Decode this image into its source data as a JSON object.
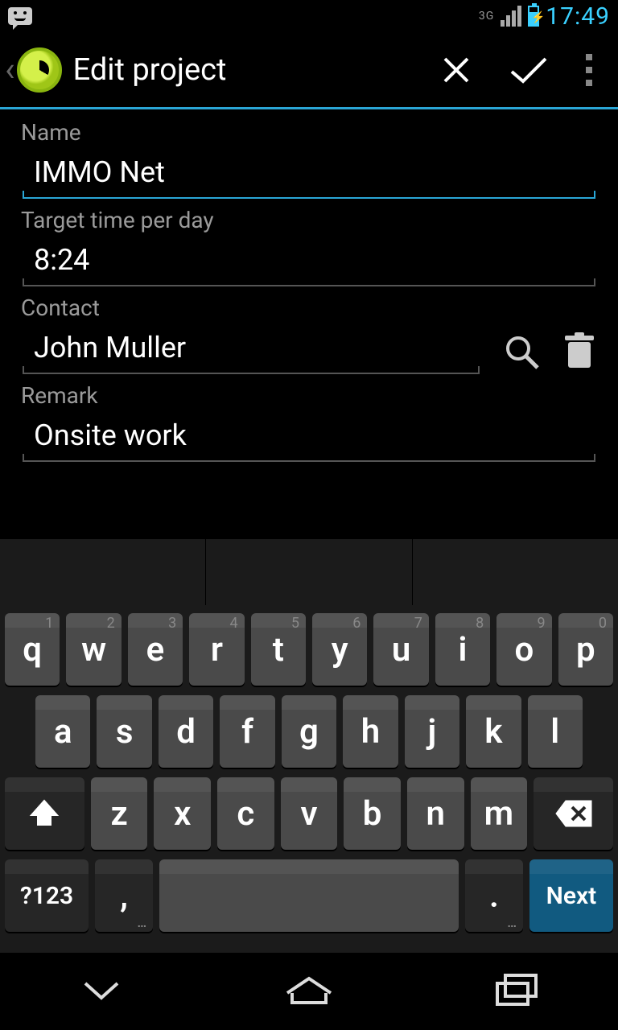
{
  "statusbar": {
    "network": "3G",
    "time": "17:49"
  },
  "actionbar": {
    "title": "Edit project"
  },
  "form": {
    "name_label": "Name",
    "name_value": "IMMO Net",
    "target_label": "Target time per day",
    "target_value": "8:24",
    "contact_label": "Contact",
    "contact_value": "John Muller",
    "remark_label": "Remark",
    "remark_value": "Onsite work"
  },
  "keyboard": {
    "row1": [
      {
        "k": "q",
        "h": "1"
      },
      {
        "k": "w",
        "h": "2"
      },
      {
        "k": "e",
        "h": "3"
      },
      {
        "k": "r",
        "h": "4"
      },
      {
        "k": "t",
        "h": "5"
      },
      {
        "k": "y",
        "h": "6"
      },
      {
        "k": "u",
        "h": "7"
      },
      {
        "k": "i",
        "h": "8"
      },
      {
        "k": "o",
        "h": "9"
      },
      {
        "k": "p",
        "h": "0"
      }
    ],
    "row2": [
      "a",
      "s",
      "d",
      "f",
      "g",
      "h",
      "j",
      "k",
      "l"
    ],
    "row3": [
      "z",
      "x",
      "c",
      "v",
      "b",
      "n",
      "m"
    ],
    "symbols": "?123",
    "comma": ",",
    "period": ".",
    "next": "Next"
  }
}
